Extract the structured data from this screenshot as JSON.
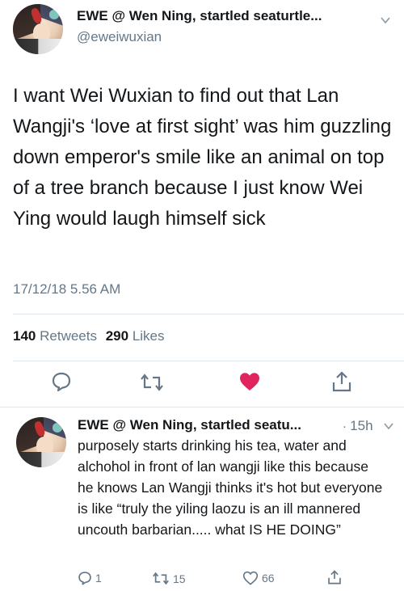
{
  "tweet": {
    "display_name": "EWE @ Wen Ning, startled seaturtle...",
    "handle": "@eweiwuxian",
    "text": "I want Wei Wuxian to find out that Lan Wangji's ‘love at first sight’ was him guzzling down emperor's smile like an animal on top of a tree branch because I just know Wei Ying would laugh himself sick",
    "timestamp": "17/12/18 5.56 AM",
    "retweets_count": "140",
    "retweets_label": "Retweets",
    "likes_count": "290",
    "likes_label": "Likes",
    "actions": {
      "reply_icon": "reply-bubble-icon",
      "retweet_icon": "retweet-arrows-icon",
      "like_icon": "heart-filled-icon",
      "share_icon": "share-upload-icon"
    },
    "liked": true
  },
  "reply": {
    "display_name": "EWE @ Wen Ning, startled seatu...",
    "separator": "·",
    "time_ago": "15h",
    "text": "purposely starts drinking his tea, water and alchohol in front of lan wangji like this because he knows Lan Wangji thinks it's hot but everyone is like “truly the yiling laozu is an ill mannered uncouth barbarian..... what IS HE DOING”",
    "reply_count": "1",
    "retweet_count": "15",
    "like_count": "66"
  },
  "colors": {
    "like_red": "#e0245e",
    "icon_gray": "#657786",
    "text_dark": "#14171a",
    "divider": "#e1e8ed"
  }
}
